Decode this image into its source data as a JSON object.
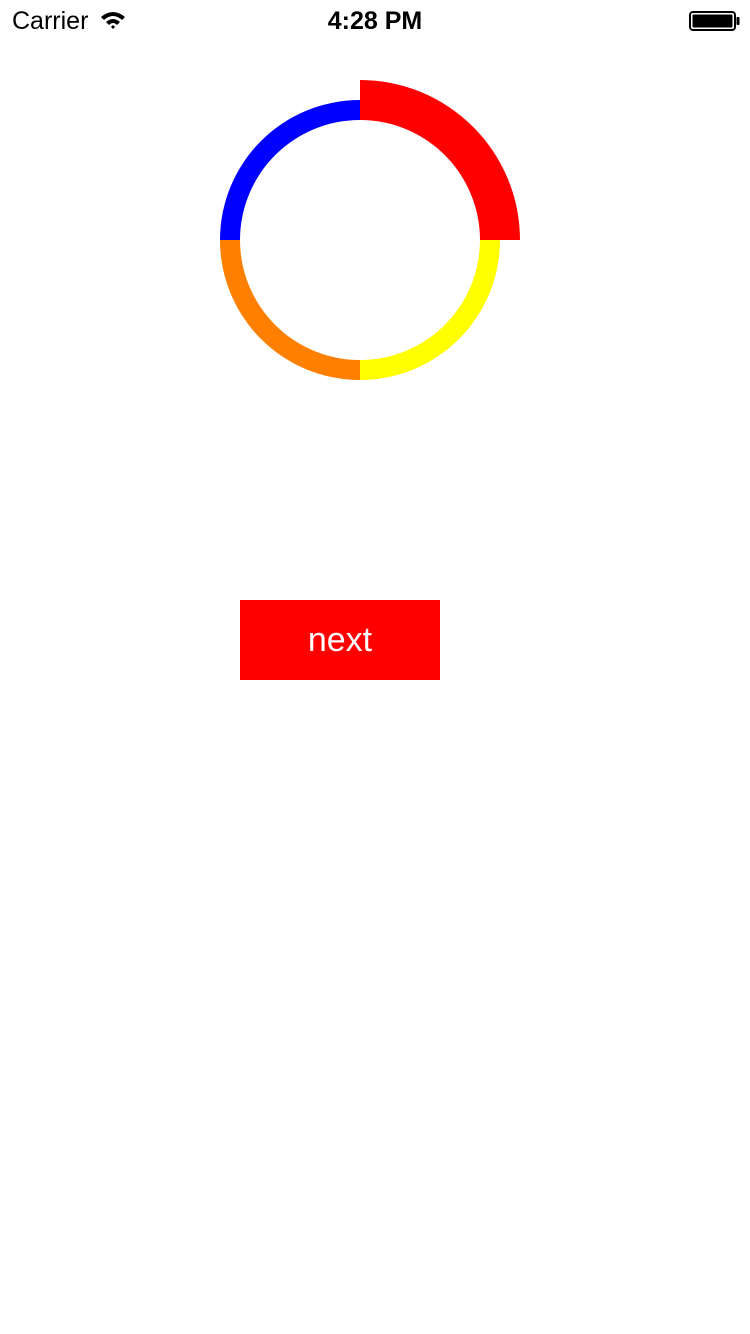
{
  "status_bar": {
    "carrier": "Carrier",
    "time": "4:28 PM",
    "wifi_icon": "wifi-icon",
    "battery_icon": "battery-full-icon"
  },
  "progress_ring": {
    "segments": [
      {
        "name": "red",
        "color": "#ff0000",
        "highlighted": true
      },
      {
        "name": "yellow",
        "color": "#ffff00",
        "highlighted": false
      },
      {
        "name": "orange",
        "color": "#ff8000",
        "highlighted": false
      },
      {
        "name": "blue",
        "color": "#0000ff",
        "highlighted": false
      }
    ]
  },
  "next_button": {
    "label": "next",
    "color": "#ff0000"
  }
}
